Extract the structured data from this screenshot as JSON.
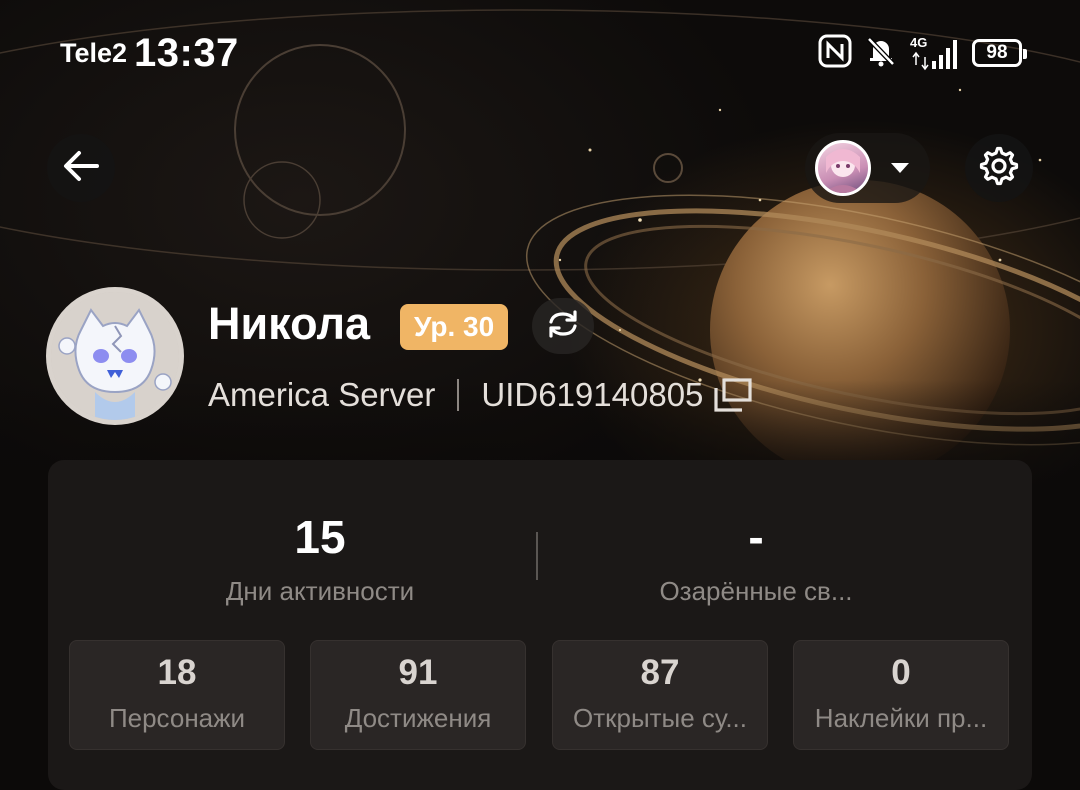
{
  "status_bar": {
    "carrier": "Tele2",
    "time": "13:37",
    "network": "4G",
    "battery": "98"
  },
  "nav": {
    "back_icon": "arrow-left-icon",
    "account_dropdown_icon": "caret-down-icon",
    "settings_icon": "gear-icon"
  },
  "profile": {
    "name": "Никола",
    "level": "Ур. 30",
    "server": "America Server",
    "uid": "UID619140805"
  },
  "stats": {
    "active_days": {
      "value": "15",
      "label": "Дни активности"
    },
    "second": {
      "value": "-",
      "label": "Озарённые св..."
    },
    "tiles": [
      {
        "value": "18",
        "label": "Персонажи"
      },
      {
        "value": "91",
        "label": "Достижения"
      },
      {
        "value": "87",
        "label": "Открытые су..."
      },
      {
        "value": "0",
        "label": "Наклейки пр..."
      }
    ]
  },
  "colors": {
    "level_badge": "#f0b565",
    "card_bg": "#1b1817",
    "tile_bg": "#2a2625",
    "muted_text": "#8f8a86"
  }
}
